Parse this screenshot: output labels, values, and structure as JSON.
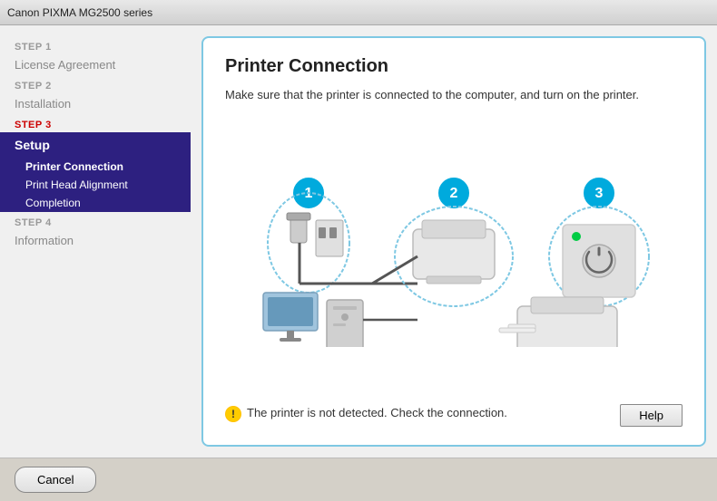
{
  "titleBar": {
    "text": "Canon PIXMA MG2500 series"
  },
  "sidebar": {
    "step1": {
      "label": "STEP 1",
      "item": "License Agreement"
    },
    "step2": {
      "label": "STEP 2",
      "item": "Installation"
    },
    "step3": {
      "label": "STEP 3",
      "groupLabel": "Setup",
      "subItems": [
        "Printer Connection",
        "Print Head Alignment",
        "Completion"
      ]
    },
    "step4": {
      "label": "STEP 4",
      "item": "Information"
    }
  },
  "mainPanel": {
    "title": "Printer Connection",
    "description": "Make sure that the printer is connected to the computer, and turn on the printer.",
    "warningIcon": "!",
    "warningText": "The printer is not detected. Check the connection.",
    "helpButton": "Help"
  },
  "bottomBar": {
    "cancelButton": "Cancel"
  }
}
